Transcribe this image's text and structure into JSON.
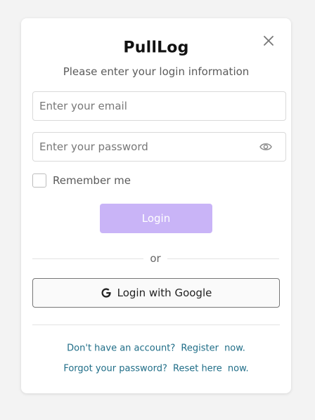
{
  "app": {
    "title": "PullLog",
    "subtitle": "Please enter your login information"
  },
  "form": {
    "email_placeholder": "Enter your email",
    "email_value": "",
    "password_placeholder": "Enter your password",
    "password_value": "",
    "remember_label": "Remember me",
    "remember_checked": false,
    "login_label": "Login",
    "or_label": "or",
    "google_label": "Login with Google"
  },
  "links": {
    "register_prompt": "Don't have an account?",
    "register_link": "Register",
    "register_suffix": "now.",
    "forgot_prompt": "Forgot your password?",
    "reset_link": "Reset here",
    "reset_suffix": "now."
  },
  "icons": {
    "close": "close-icon",
    "eye": "eye-icon",
    "google": "google-icon"
  },
  "colors": {
    "login_button_bg": "#c9b4f7",
    "link_color": "#1f6d87",
    "page_bg": "#f3f3f3"
  }
}
